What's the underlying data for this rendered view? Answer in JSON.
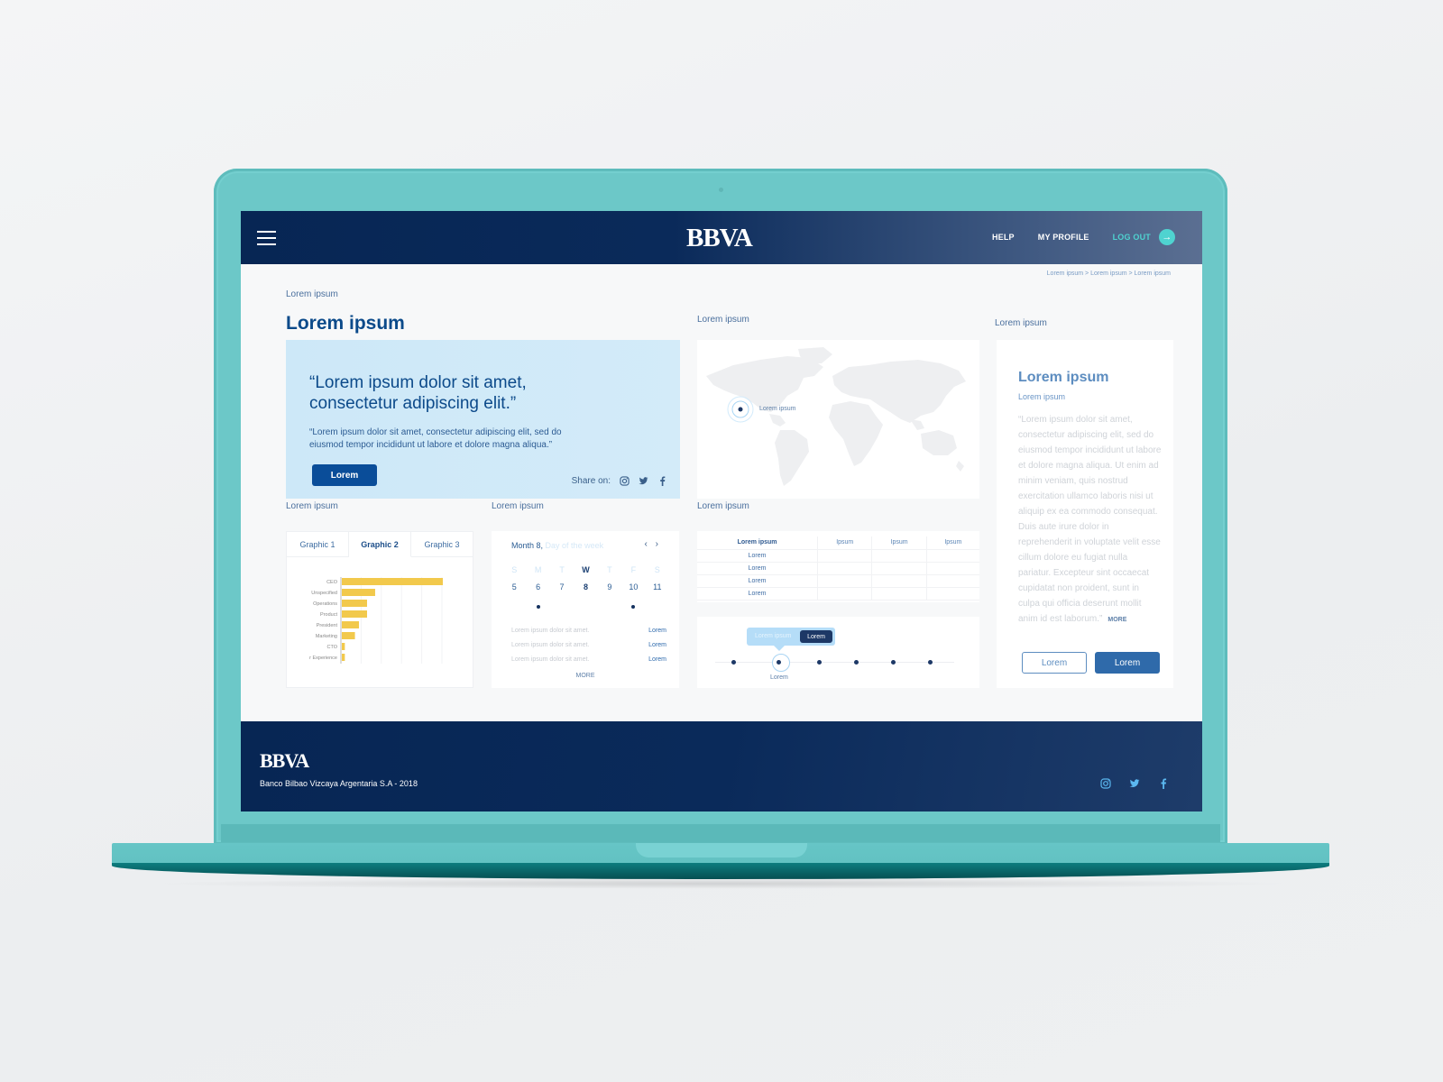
{
  "header": {
    "logo": "BBVA",
    "nav": [
      {
        "label": "HELP"
      },
      {
        "label": "MY PROFILE"
      },
      {
        "label": "LOG OUT"
      }
    ],
    "logout_icon": "arrow-right-icon",
    "breadcrumb": "Lorem ipsum > Lorem ipsum > Lorem ipsum"
  },
  "page": {
    "overline": "Lorem ipsum",
    "title": "Lorem ipsum"
  },
  "hero": {
    "quote": "“Lorem ipsum dolor sit amet, consectetur adipiscing elit.”",
    "body": "“Lorem ipsum dolor sit amet, consectetur adipiscing elit, sed do eiusmod tempor incididunt ut labore et dolore magna aliqua.”",
    "button": "Lorem",
    "share_label": "Share on:",
    "share_icons": [
      "instagram-icon",
      "twitter-icon",
      "facebook-icon"
    ]
  },
  "map": {
    "section_label": "Lorem ipsum",
    "marker_label": "Lorem ipsum"
  },
  "article": {
    "section_label": "Lorem ipsum",
    "title": "Lorem ipsum",
    "subtitle": "Lorem ipsum",
    "body": "“Lorem ipsum dolor sit amet, consectetur adipiscing elit, sed do eiusmod tempor incididunt ut labore et dolore magna aliqua. Ut enim ad minim veniam, quis nostrud exercitation ullamco laboris nisi ut aliquip ex ea commodo consequat. Duis aute irure dolor in reprehenderit in voluptate velit esse cillum dolore eu fugiat nulla pariatur. Excepteur sint occaecat cupidatat non proident, sunt in culpa qui officia deserunt mollit anim id est laborum.”",
    "more": "MORE",
    "button_outline": "Lorem",
    "button_solid": "Lorem"
  },
  "graphics": {
    "section_label": "Lorem ipsum",
    "tabs": [
      {
        "label": "Graphic 1",
        "active": false
      },
      {
        "label": "Graphic 2",
        "active": true
      },
      {
        "label": "Graphic 3",
        "active": false
      }
    ]
  },
  "chart_data": {
    "type": "bar",
    "orientation": "horizontal",
    "categories": [
      "CEO",
      "Unspecified",
      "Operations",
      "Product",
      "President",
      "Marketing",
      "CTO",
      "r Experience"
    ],
    "values": [
      100,
      33,
      25,
      25,
      17,
      13,
      3,
      3
    ],
    "xlim": [
      0,
      100
    ],
    "grid": true,
    "color": "#f2c94c",
    "title": "",
    "xlabel": "",
    "ylabel": ""
  },
  "calendar": {
    "section_label": "Lorem ipsum",
    "month": "Month 8,",
    "weekday_hint": "Day of the week",
    "nav": "‹ ›",
    "weekdays": [
      "S",
      "M",
      "T",
      "W",
      "T",
      "F",
      "S"
    ],
    "active_weekday_index": 3,
    "days": [
      "5",
      "6",
      "7",
      "8",
      "9",
      "10",
      "11"
    ],
    "active_day": "8",
    "event_days": [
      "6",
      "10"
    ],
    "events": [
      {
        "text": "Lorem ipsum dolor sit amet.",
        "link": "Lorem"
      },
      {
        "text": "Lorem ipsum dolor sit amet.",
        "link": "Lorem"
      },
      {
        "text": "Lorem ipsum dolor sit amet.",
        "link": "Lorem"
      }
    ],
    "more": "MORE"
  },
  "table": {
    "section_label": "Lorem ipsum",
    "headers": [
      "Lorem ipsum",
      "Ipsum",
      "Ipsum",
      "Ipsum"
    ],
    "rows": [
      [
        "Lorem",
        "",
        "",
        ""
      ],
      [
        "Lorem",
        "",
        "",
        ""
      ],
      [
        "Lorem",
        "",
        "",
        ""
      ],
      [
        "Lorem",
        "",
        "",
        ""
      ]
    ]
  },
  "slider": {
    "tooltip_text": "Lorem ipsum",
    "tooltip_button": "Lorem",
    "steps": 6,
    "selected_index": 1,
    "selected_label": "Lorem"
  },
  "footer": {
    "logo": "BBVA",
    "text": "Banco Bilbao Vizcaya Argentaria S.A - 2018",
    "social_icons": [
      "instagram-icon",
      "twitter-icon",
      "facebook-icon"
    ]
  },
  "colors": {
    "navy": "#072654",
    "accent_teal": "#4fd3d0",
    "primary_blue": "#0a4d99",
    "hero_bg": "#cde8f8",
    "bar_yellow": "#f2c94c",
    "laptop": "#6cc8c8"
  }
}
